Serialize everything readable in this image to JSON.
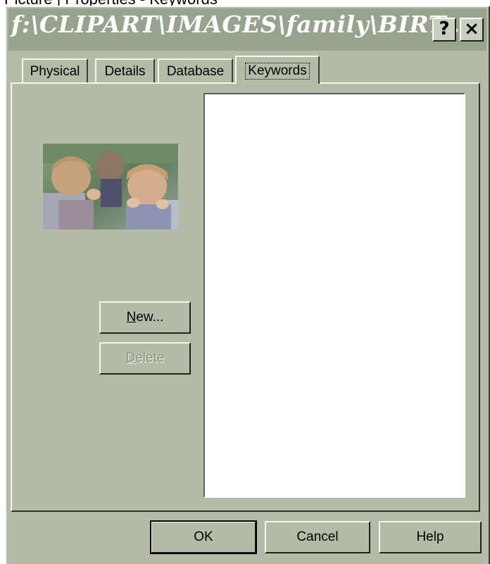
{
  "caption": "Picture | Properties - Keywords",
  "window": {
    "title": "f:\\CLIPART\\IMAGES\\family\\BIRT...",
    "help_button": "?",
    "close_button": "×"
  },
  "tabs": [
    {
      "label": "Physical"
    },
    {
      "label": "Details"
    },
    {
      "label": "Database"
    },
    {
      "label": "Keywords"
    }
  ],
  "buttons": {
    "new_mnemonic": "N",
    "new_rest": "ew...",
    "delete_mnemonic": "D",
    "delete_rest": "elete",
    "ok": "OK",
    "cancel": "Cancel",
    "help": "Help"
  },
  "thumbnail": {
    "icon": "photo-children-thumbnail"
  },
  "colors": {
    "dialog_face": "#b4bca8",
    "titlebar": "#97a38c",
    "listbox_bg": "#ffffff"
  }
}
